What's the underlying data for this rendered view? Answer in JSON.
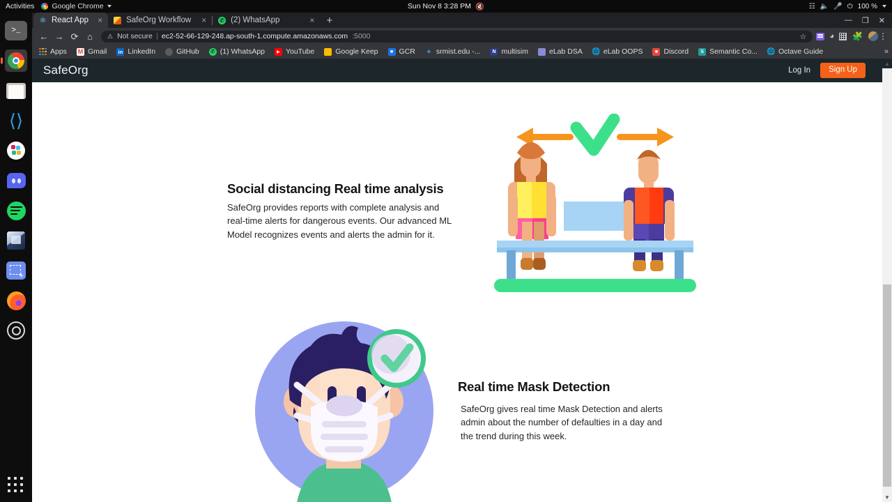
{
  "os": {
    "activities": "Activities",
    "app_menu": "Google Chrome",
    "clock": "Sun Nov 8  3:28 PM",
    "battery": "100 %",
    "tray_icons": [
      "network-icon",
      "volume-icon",
      "microphone-icon",
      "battery-icon"
    ],
    "dock": [
      {
        "name": "terminal",
        "label": ">_"
      },
      {
        "name": "google-chrome",
        "label": "Google Chrome"
      },
      {
        "name": "files",
        "label": "Files"
      },
      {
        "name": "vscode",
        "label": "Visual Studio Code"
      },
      {
        "name": "slack",
        "label": "Slack"
      },
      {
        "name": "discord",
        "label": "Discord"
      },
      {
        "name": "spotify",
        "label": "Spotify"
      },
      {
        "name": "virtualbox",
        "label": "VirtualBox"
      },
      {
        "name": "screenshot",
        "label": "Screenshot"
      },
      {
        "name": "firefox",
        "label": "Firefox"
      },
      {
        "name": "settings",
        "label": "Settings"
      },
      {
        "name": "show-applications",
        "label": "Show Applications"
      }
    ]
  },
  "browser": {
    "tabs": [
      {
        "title": "React App",
        "icon": "react-icon",
        "active": true,
        "close": "×"
      },
      {
        "title": "SafeOrg Workflow - Cre",
        "icon": "workflow-icon",
        "active": false,
        "close": "×"
      },
      {
        "title": "(2) WhatsApp",
        "icon": "whatsapp-icon",
        "active": false,
        "close": "×"
      }
    ],
    "new_tab": "+",
    "window_controls": {
      "minimize": "—",
      "maximize": "❐",
      "close": "✕"
    },
    "nav": {
      "back": "←",
      "forward": "→",
      "reload": "⟳",
      "home": "⌂"
    },
    "omnibox": {
      "warning_icon": "⚠",
      "security_label": "Not secure",
      "url": "ec2-52-66-129-248.ap-south-1.compute.amazonaws.com",
      "port": ":5000",
      "star": "☆"
    },
    "toolbar_icons": [
      "extension-icon",
      "cast-icon",
      "grid-icon",
      "puzzle-icon",
      "avatar-icon",
      "kebab-menu-icon"
    ],
    "bookmarks": [
      {
        "label": "Apps",
        "icon": "apps-grid-icon"
      },
      {
        "label": "Gmail",
        "icon": "gmail-icon"
      },
      {
        "label": "LinkedIn",
        "icon": "linkedin-icon"
      },
      {
        "label": "GitHub",
        "icon": "github-icon"
      },
      {
        "label": "(1) WhatsApp",
        "icon": "whatsapp-icon"
      },
      {
        "label": "YouTube",
        "icon": "youtube-icon"
      },
      {
        "label": "Google Keep",
        "icon": "google-keep-icon"
      },
      {
        "label": "GCR",
        "icon": "google-classroom-icon"
      },
      {
        "label": "srmist.edu -...",
        "icon": "srmist-icon"
      },
      {
        "label": "multisim",
        "icon": "multisim-icon"
      },
      {
        "label": "eLab DSA",
        "icon": "elab-dsa-icon"
      },
      {
        "label": "eLab OOPS",
        "icon": "globe-icon"
      },
      {
        "label": "Discord",
        "icon": "discord-icon"
      },
      {
        "label": "Semantic Co...",
        "icon": "semantic-icon"
      },
      {
        "label": "Octave Guide",
        "icon": "globe-icon"
      }
    ],
    "bookmarks_overflow": "»"
  },
  "site": {
    "brand": "SafeOrg",
    "accent_color": "#f4611a",
    "navbar_color": "#1d262b",
    "login_label": "Log In",
    "signup_label": "Sign Up",
    "sections": [
      {
        "heading": "Social distancing Real time analysis",
        "body": "SafeOrg provides reports with complete analysis and real-time alerts for dangerous events. Our advanced ML Model recognizes events and alerts the admin for it.",
        "illustration": "social-distancing-bench-illustration"
      },
      {
        "heading": "Real time Mask Detection",
        "body": "SafeOrg gives real time Mask Detection and alerts admin about the number of defaulties in a day and the trend during this week.",
        "illustration": "mask-detection-face-illustration"
      }
    ]
  }
}
